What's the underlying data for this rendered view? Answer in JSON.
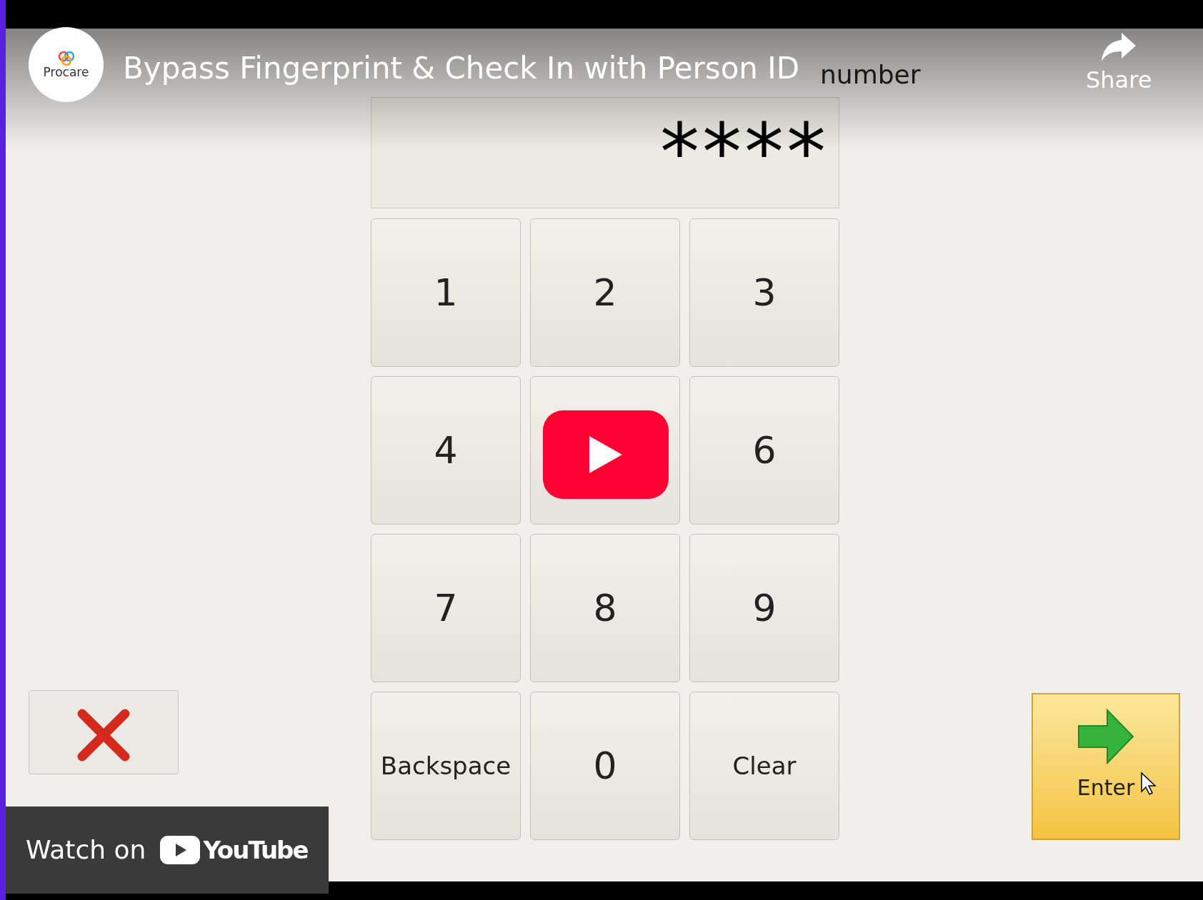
{
  "video": {
    "channel_logo": "Procare",
    "title": "Bypass Fingerprint & Check In with Person ID",
    "share": "Share",
    "watch_on": "Watch on",
    "youtube": "YouTube"
  },
  "app": {
    "prompt": "number",
    "pin": "****",
    "keys": [
      {
        "kind": "digit",
        "label": "1"
      },
      {
        "kind": "digit",
        "label": "2"
      },
      {
        "kind": "digit",
        "label": "3"
      },
      {
        "kind": "digit",
        "label": "4"
      },
      {
        "kind": "digit"
      },
      {
        "kind": "digit",
        "label": "6"
      },
      {
        "kind": "digit",
        "label": "7"
      },
      {
        "kind": "digit",
        "label": "8"
      },
      {
        "kind": "digit",
        "label": "9"
      },
      {
        "kind": "action",
        "label": "Backspace"
      },
      {
        "kind": "digit",
        "label": "0"
      },
      {
        "kind": "action",
        "label": "Clear"
      }
    ],
    "enter": "Enter"
  }
}
